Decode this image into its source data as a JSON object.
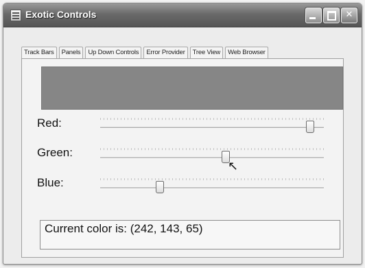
{
  "window": {
    "title": "Exotic Controls",
    "controls": {
      "minimize": "",
      "maximize": "",
      "close": "✕"
    }
  },
  "tabs": [
    {
      "label": "Track Bars",
      "active": true
    },
    {
      "label": "Panels",
      "active": false
    },
    {
      "label": "Up Down Controls",
      "active": false
    },
    {
      "label": "Error Provider",
      "active": false
    },
    {
      "label": "Tree View",
      "active": false
    },
    {
      "label": "Web Browser",
      "active": false
    }
  ],
  "color_preview": {
    "color": "#868686"
  },
  "sliders": [
    {
      "label": "Red:",
      "value": 242,
      "max": 255
    },
    {
      "label": "Green:",
      "value": 143,
      "max": 255
    },
    {
      "label": "Blue:",
      "value": 65,
      "max": 255
    }
  ],
  "status": {
    "text": "Current color is: (242, 143, 65)"
  },
  "cursor_icon": "arrow-cursor-icon"
}
